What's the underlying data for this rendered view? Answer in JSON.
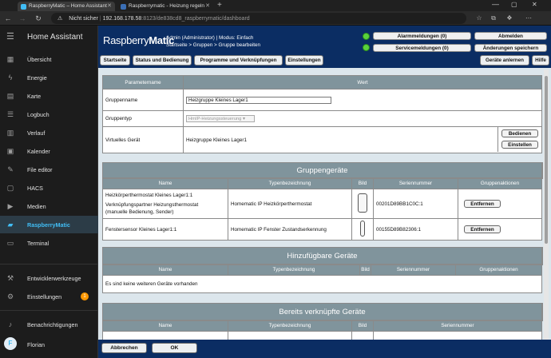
{
  "browser": {
    "tabs": [
      {
        "title": "RaspberryMatic – Home Assistant",
        "active": true
      },
      {
        "title": "Raspberrymatic - Heizung regeln",
        "active": false
      }
    ],
    "security_label": "Nicht sicher",
    "url_host": "192.168.178.58",
    "url_rest": ":8123/de838cd8_raspberrymatic/dashboard"
  },
  "sidebar": {
    "title": "Home Assistant",
    "items": [
      {
        "label": "Übersicht",
        "icon": "grid-icon"
      },
      {
        "label": "Energie",
        "icon": "lightning-icon"
      },
      {
        "label": "Karte",
        "icon": "map-icon"
      },
      {
        "label": "Logbuch",
        "icon": "list-icon"
      },
      {
        "label": "Verlauf",
        "icon": "chart-icon"
      },
      {
        "label": "Kalender",
        "icon": "calendar-icon"
      },
      {
        "label": "File editor",
        "icon": "wrench-icon"
      },
      {
        "label": "HACS",
        "icon": "hacs-icon"
      },
      {
        "label": "Medien",
        "icon": "media-icon"
      },
      {
        "label": "RaspberryMatic",
        "icon": "raspberrymatic-icon"
      },
      {
        "label": "Terminal",
        "icon": "terminal-icon"
      }
    ],
    "bottom": [
      {
        "label": "Entwicklerwerkzeuge",
        "icon": "hammer-icon"
      },
      {
        "label": "Einstellungen",
        "icon": "settings-icon",
        "badge": "1"
      },
      {
        "label": "Benachrichtigungen",
        "icon": "bell-icon"
      }
    ],
    "user": {
      "initial": "F",
      "name": "Florian"
    }
  },
  "rm": {
    "logo_a": "Raspberry",
    "logo_b": "Matic",
    "user_line": "Admin (Administrator) | Modus: Einfach",
    "breadcrumb": "Startseite > Gruppen > Gruppe bearbeiten",
    "alarm": "Alarmmeldungen (0)",
    "service": "Servicemeldungen (0)",
    "logout": "Abmelden",
    "save_changes": "Änderungen speichern",
    "nav": [
      "Startseite",
      "Status und Bedienung",
      "Programme und Verknüpfungen",
      "Einstellungen"
    ],
    "teach": "Geräte anlernen",
    "help": "Hilfe"
  },
  "params": {
    "col_name": "Parametername",
    "col_value": "Wert",
    "rows": {
      "group_name_label": "Gruppenname",
      "group_name_value": "Heizgruppe Kleines Lager1",
      "group_type_label": "Gruppentyp",
      "group_type_value": "HmIP-Heizungssteuerung",
      "virtual_label": "Virtuelles Gerät",
      "virtual_value": "Heizgruppe Kleines Lager1",
      "operate": "Bedienen",
      "settings": "Einstellen"
    }
  },
  "group_devices": {
    "title": "Gruppengeräte",
    "cols": [
      "Name",
      "Typenbezeichnung",
      "Bild",
      "Seriennummer",
      "Gruppenaktionen"
    ],
    "rows": [
      {
        "name1": "Heizkörperthermostat Kleines Lager1:1",
        "name2": "Verknüpfungspartner Heizungsthermostat",
        "name3": "(manuelle Bedienung, Sender)",
        "type": "Homematic IP Heizkörperthermostat",
        "serial": "00201D89BB1C0C:1",
        "action": "Entfernen"
      },
      {
        "name1": "Fenstersensor Kleines Lager1:1",
        "name2": "",
        "name3": "",
        "type": "Homematic IP Fenster Zustandserkennung",
        "serial": "00155D89B82306:1",
        "action": "Entfernen"
      }
    ]
  },
  "addable": {
    "title": "Hinzufügbare Geräte",
    "cols": [
      "Name",
      "Typenbezeichnung",
      "Bild",
      "Seriennummer",
      "Gruppenaktionen"
    ],
    "empty": "Es sind keine weiteren Geräte vorhanden"
  },
  "linked": {
    "title": "Bereits verknüpfte Geräte",
    "cols": [
      "Name",
      "Typenbezeichnung",
      "Bild",
      "Seriennummer"
    ]
  },
  "footer": {
    "cancel": "Abbrechen",
    "ok": "OK"
  }
}
